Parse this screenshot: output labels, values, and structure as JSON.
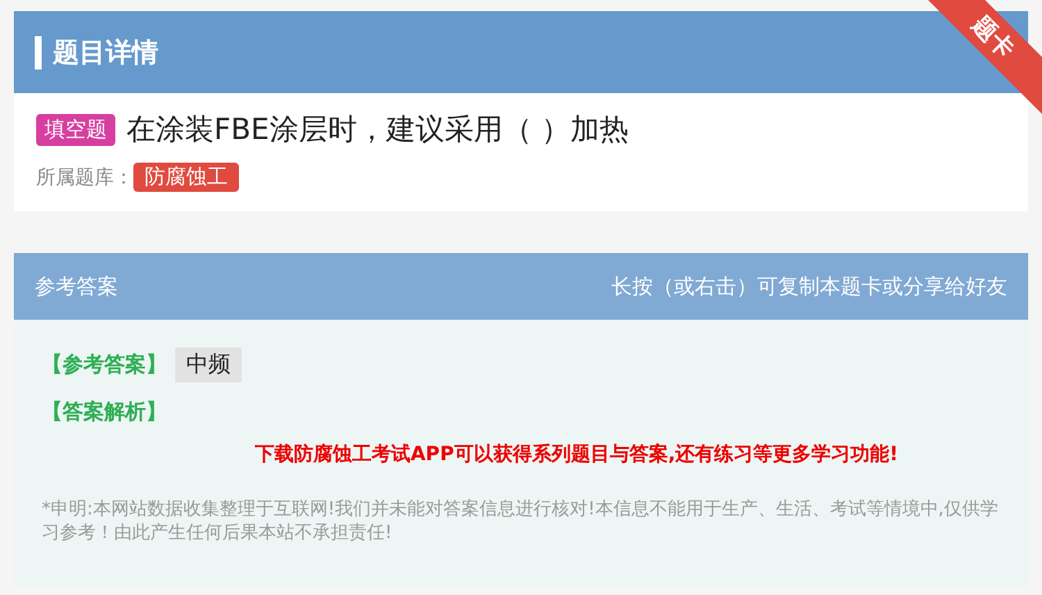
{
  "header": {
    "title": "题目详情",
    "ribbon": "题卡"
  },
  "question": {
    "type_badge": "填空题",
    "text": "在涂装FBE涂层时，建议采用（ ）加热",
    "bank_label": "所属题库：",
    "bank": "防腐蚀工"
  },
  "answer_panel": {
    "title": "参考答案",
    "hint": "长按（或右击）可复制本题卡或分享给好友",
    "answer_label": "【参考答案】",
    "answer": "中频",
    "analysis_label": "【答案解析】",
    "promo": "下载防腐蚀工考试APP可以获得系列题目与答案,还有练习等更多学习功能!",
    "disclaimer": "*申明:本网站数据收集整理于互联网!我们并未能对答案信息进行核对!本信息不能用于生产、生活、考试等情境中,仅供学习参考！由此产生任何后果本站不承担责任!"
  }
}
